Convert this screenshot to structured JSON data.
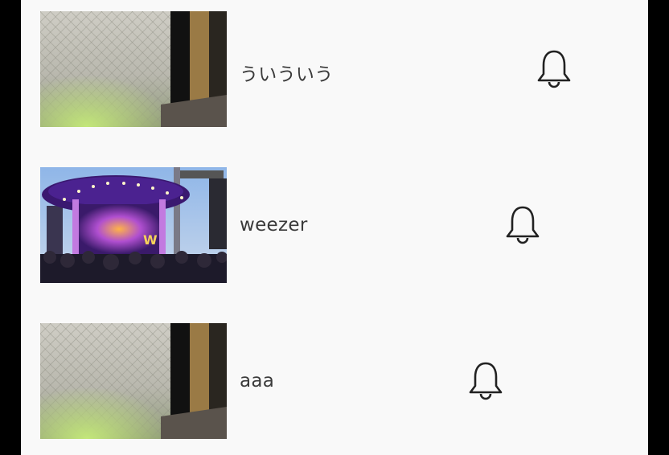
{
  "notification_list": {
    "items": [
      {
        "title": "ういういう",
        "thumbnail": "window-screen-photo",
        "icon": "bell-outline-icon"
      },
      {
        "title": "weezer",
        "thumbnail": "concert-stage-photo",
        "icon": "bell-outline-icon"
      },
      {
        "title": "aaa",
        "thumbnail": "window-screen-photo",
        "icon": "bell-outline-icon"
      }
    ]
  },
  "colors": {
    "background": "#f9f9f9",
    "title_text": "#3a3a3a",
    "icon_stroke": "#222222",
    "frame": "#000000"
  }
}
